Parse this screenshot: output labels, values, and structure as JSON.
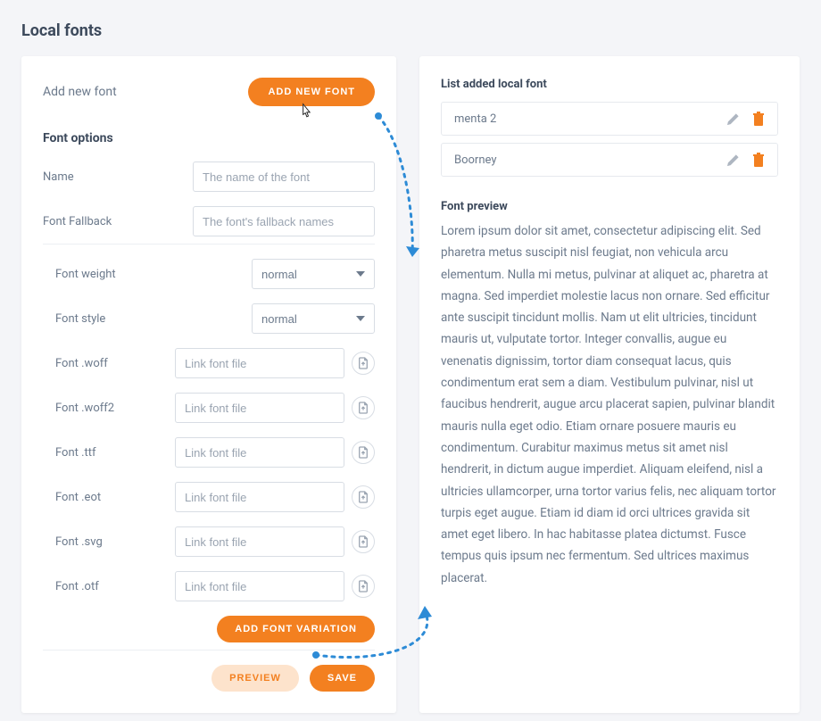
{
  "page": {
    "title": "Local fonts"
  },
  "left": {
    "addFontLabel": "Add new font",
    "addFontBtn": "ADD NEW FONT",
    "optionsHeading": "Font options",
    "nameLabel": "Name",
    "namePlaceholder": "The name of the font",
    "fallbackLabel": "Font Fallback",
    "fallbackPlaceholder": "The font's fallback names",
    "weightLabel": "Font weight",
    "weightValue": "normal",
    "styleLabel": "Font style",
    "styleValue": "normal",
    "fileRows": [
      {
        "label": "Font .woff",
        "placeholder": "Link font file"
      },
      {
        "label": "Font .woff2",
        "placeholder": "Link font file"
      },
      {
        "label": "Font .ttf",
        "placeholder": "Link font file"
      },
      {
        "label": "Font .eot",
        "placeholder": "Link font file"
      },
      {
        "label": "Font .svg",
        "placeholder": "Link font file"
      },
      {
        "label": "Font .otf",
        "placeholder": "Link font file"
      }
    ],
    "addVariationBtn": "ADD FONT VARIATION",
    "previewBtn": "PREVIEW",
    "saveBtn": "SAVE"
  },
  "right": {
    "listHeading": "List added local font",
    "fonts": [
      {
        "name": "menta 2"
      },
      {
        "name": "Boorney"
      }
    ],
    "previewHeading": "Font preview",
    "previewBody": "Lorem ipsum dolor sit amet, consectetur adipiscing elit. Sed pharetra metus suscipit nisl feugiat, non vehicula arcu elementum. Nulla mi metus, pulvinar at aliquet ac, pharetra at magna. Sed imperdiet molestie lacus non ornare. Sed efficitur ante suscipit tincidunt mollis. Nam ut elit ultricies, tincidunt mauris ut, vulputate tortor. Integer convallis, augue eu venenatis dignissim, tortor diam consequat lacus, quis condimentum erat sem a diam. Vestibulum pulvinar, nisl ut faucibus hendrerit, augue arcu placerat sapien, pulvinar blandit mauris nulla eget odio. Etiam ornare posuere mauris eu condimentum. Curabitur maximus metus sit amet nisl hendrerit, in dictum augue imperdiet. Aliquam eleifend, nisl a ultricies ullamcorper, urna tortor varius felis, nec aliquam tortor turpis eget augue. Etiam id diam id orci ultrices gravida sit amet eget libero. In hac habitasse platea dictumst. Fusce tempus quis ipsum nec fermentum. Sed ultrices maximus placerat."
  }
}
